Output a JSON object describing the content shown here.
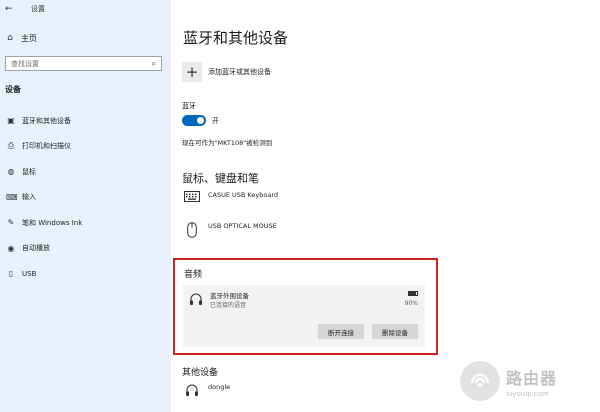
{
  "window": {
    "title": "设置"
  },
  "sidebar": {
    "home": "主页",
    "search_placeholder": "查找设置",
    "section": "设备",
    "items": [
      {
        "label": "蓝牙和其他设备",
        "icon": "bluetooth-devices-icon"
      },
      {
        "label": "打印机和扫描仪",
        "icon": "printer-icon"
      },
      {
        "label": "鼠标",
        "icon": "mouse-icon"
      },
      {
        "label": "输入",
        "icon": "keyboard-icon"
      },
      {
        "label": "笔和 Windows Ink",
        "icon": "pen-icon"
      },
      {
        "label": "自动播放",
        "icon": "autoplay-icon"
      },
      {
        "label": "USB",
        "icon": "usb-icon"
      }
    ]
  },
  "main": {
    "title": "蓝牙和其他设备",
    "add_device": "添加蓝牙或其他设备",
    "bluetooth_label": "蓝牙",
    "bluetooth_state": "开",
    "discoverable": "现在可作为\"MKT108\"被检测到",
    "kbd_heading": "鼠标、键盘和笔",
    "kbd_devices": [
      {
        "name": "CASUE USB Keyboard",
        "icon": "keyboard-icon"
      },
      {
        "name": "USB OPTICAL MOUSE",
        "icon": "mouse-icon"
      }
    ],
    "audio": {
      "heading": "音频",
      "device_name": "蓝牙外围设备",
      "status": "已连接的语音",
      "battery": "90%",
      "battery_level": 0.9,
      "disconnect": "断开连接",
      "remove": "删除设备"
    },
    "other_heading": "其他设备",
    "other_devices": [
      {
        "name": "dongle",
        "icon": "headphones-icon"
      }
    ]
  },
  "watermark": {
    "cn": "路由器",
    "en": "luyouqi.com"
  },
  "colors": {
    "sidebar_bg": "#e8f1fb",
    "accent": "#0067c0",
    "highlight": "#cc2222"
  }
}
